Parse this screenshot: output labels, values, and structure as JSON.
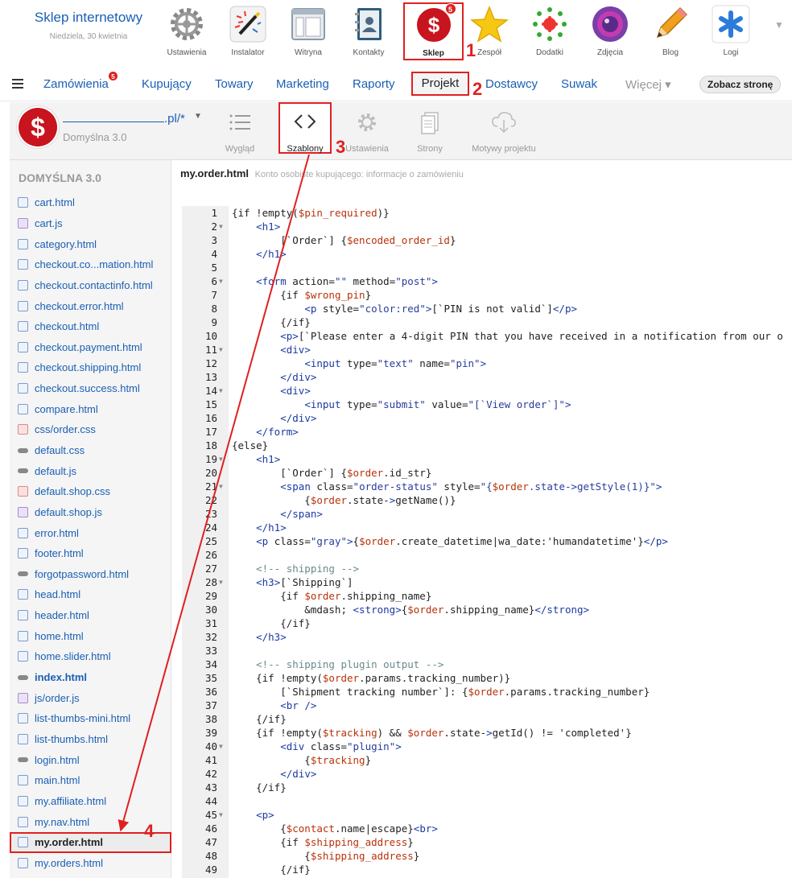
{
  "brand": {
    "title": "Sklep internetowy",
    "date": "Niedziela, 30 kwietnia"
  },
  "apps": [
    {
      "label": "Ustawienia",
      "icon": "gear-icon"
    },
    {
      "label": "Instalator",
      "icon": "magic-wand-icon"
    },
    {
      "label": "Witryna",
      "icon": "site-window-icon"
    },
    {
      "label": "Kontakty",
      "icon": "contacts-book-icon"
    },
    {
      "label": "Sklep",
      "icon": "shop-dollar-icon",
      "badge": "5",
      "active": true
    },
    {
      "label": "Zespół",
      "icon": "star-icon"
    },
    {
      "label": "Dodatki",
      "icon": "plugins-icon"
    },
    {
      "label": "Zdjęcia",
      "icon": "photos-icon"
    },
    {
      "label": "Blog",
      "icon": "pencil-icon"
    },
    {
      "label": "Logi",
      "icon": "asterisk-icon"
    }
  ],
  "nav": {
    "orders": "Zamówienia",
    "orders_badge": "5",
    "customers": "Kupujący",
    "products": "Towary",
    "marketing": "Marketing",
    "reports": "Raporty",
    "project": "Projekt",
    "suppliers": "Dostawcy",
    "slider": "Suwak",
    "more": "Więcej ▾",
    "view_site": "Zobacz stronę"
  },
  "project": {
    "url_suffix": ".pl/*",
    "subtitle": "Domyślna 3.0",
    "tools": [
      {
        "label": "Wygląd",
        "icon": "list-icon"
      },
      {
        "label": "Szablony",
        "icon": "code-brackets-icon",
        "active": true
      },
      {
        "label": "Ustawienia",
        "icon": "gear-icon"
      },
      {
        "label": "Strony",
        "icon": "pages-icon"
      },
      {
        "label": "Motywy projektu",
        "icon": "cloud-download-icon"
      }
    ]
  },
  "sidebar": {
    "title": "DOMYŚLNA 3.0",
    "files": [
      {
        "name": "cart.html",
        "type": "html"
      },
      {
        "name": "cart.js",
        "type": "js"
      },
      {
        "name": "category.html",
        "type": "html"
      },
      {
        "name": "checkout.co...mation.html",
        "type": "html"
      },
      {
        "name": "checkout.contactinfo.html",
        "type": "html"
      },
      {
        "name": "checkout.error.html",
        "type": "html"
      },
      {
        "name": "checkout.html",
        "type": "html"
      },
      {
        "name": "checkout.payment.html",
        "type": "html"
      },
      {
        "name": "checkout.shipping.html",
        "type": "html"
      },
      {
        "name": "checkout.success.html",
        "type": "html"
      },
      {
        "name": "compare.html",
        "type": "html"
      },
      {
        "name": "css/order.css",
        "type": "css"
      },
      {
        "name": "default.css",
        "type": "link"
      },
      {
        "name": "default.js",
        "type": "link"
      },
      {
        "name": "default.shop.css",
        "type": "css"
      },
      {
        "name": "default.shop.js",
        "type": "js"
      },
      {
        "name": "error.html",
        "type": "html"
      },
      {
        "name": "footer.html",
        "type": "html"
      },
      {
        "name": "forgotpassword.html",
        "type": "link"
      },
      {
        "name": "head.html",
        "type": "html"
      },
      {
        "name": "header.html",
        "type": "html"
      },
      {
        "name": "home.html",
        "type": "html"
      },
      {
        "name": "home.slider.html",
        "type": "html"
      },
      {
        "name": "index.html",
        "type": "link",
        "bold": true
      },
      {
        "name": "js/order.js",
        "type": "js"
      },
      {
        "name": "list-thumbs-mini.html",
        "type": "html"
      },
      {
        "name": "list-thumbs.html",
        "type": "html"
      },
      {
        "name": "login.html",
        "type": "link"
      },
      {
        "name": "main.html",
        "type": "html"
      },
      {
        "name": "my.affiliate.html",
        "type": "html"
      },
      {
        "name": "my.nav.html",
        "type": "html"
      },
      {
        "name": "my.order.html",
        "type": "html",
        "selected": true
      },
      {
        "name": "my.orders.html",
        "type": "html"
      }
    ]
  },
  "editor": {
    "file": "my.order.html",
    "description": "Konto osobiste kupującego: informacje o zamówieniu",
    "lines": [
      "{if !empty($pin_required)}",
      "    <h1>",
      "        [`Order`] {$encoded_order_id}",
      "    </h1>",
      "",
      "    <form action=\"\" method=\"post\">",
      "        {if $wrong_pin}",
      "            <p style=\"color:red\">[`PIN is not valid`]</p>",
      "        {/if}",
      "        <p>[`Please enter a 4-digit PIN that you have received in a notification from our o",
      "        <div>",
      "            <input type=\"text\" name=\"pin\">",
      "        </div>",
      "        <div>",
      "            <input type=\"submit\" value=\"[`View order`]\">",
      "        </div>",
      "    </form>",
      "{else}",
      "    <h1>",
      "        [`Order`] {$order.id_str}",
      "        <span class=\"order-status\" style=\"{$order.state->getStyle(1)}\">",
      "            {$order.state->getName()}",
      "        </span>",
      "    </h1>",
      "    <p class=\"gray\">{$order.create_datetime|wa_date:'humandatetime'}</p>",
      "",
      "    <!-- shipping -->",
      "    <h3>[`Shipping`]",
      "        {if $order.shipping_name}",
      "            &mdash; <strong>{$order.shipping_name}</strong>",
      "        {/if}",
      "    </h3>",
      "",
      "    <!-- shipping plugin output -->",
      "    {if !empty($order.params.tracking_number)}",
      "        [`Shipment tracking number`]: {$order.params.tracking_number}",
      "        <br />",
      "    {/if}",
      "    {if !empty($tracking) && $order.state->getId() != 'completed'}",
      "        <div class=\"plugin\">",
      "            {$tracking}",
      "        </div>",
      "    {/if}",
      "",
      "    <p>",
      "        {$contact.name|escape}<br>",
      "        {if $shipping_address}",
      "            {$shipping_address}",
      "        {/if}"
    ],
    "fold_lines": [
      2,
      6,
      11,
      14,
      19,
      21,
      28,
      40,
      45
    ]
  },
  "annotations": [
    "1",
    "2",
    "3",
    "4"
  ],
  "colors": {
    "accent": "#e02020",
    "link": "#1a5fb4"
  }
}
